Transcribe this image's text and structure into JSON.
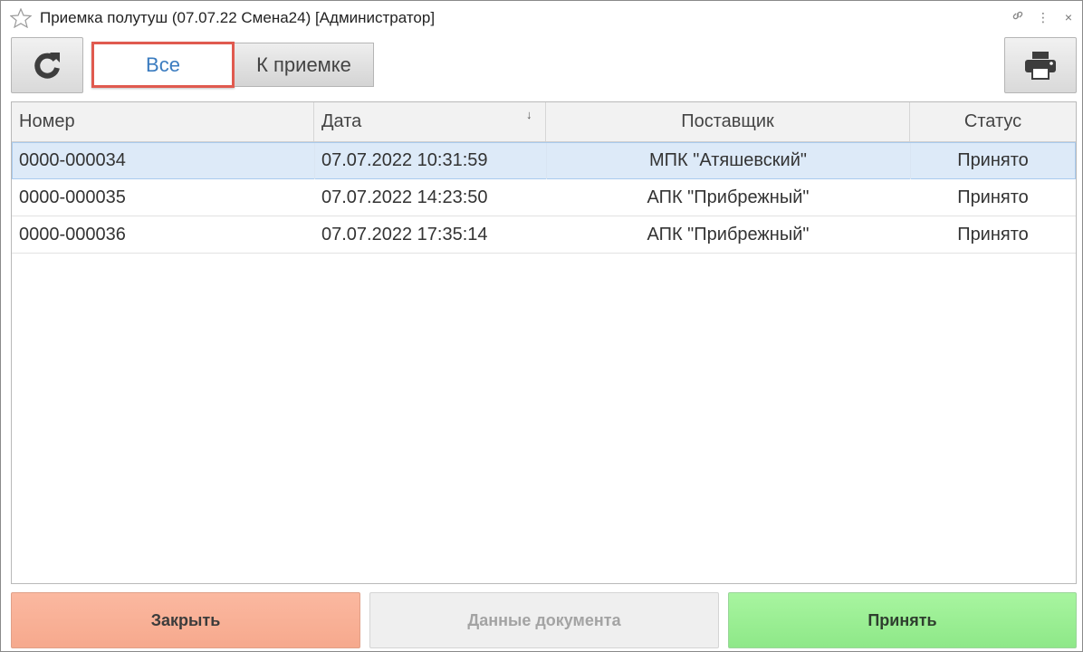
{
  "window": {
    "title": "Приемка полутуш (07.07.22 Смена24) [Администратор]",
    "icons": {
      "star": "star-outline-icon",
      "link": "link-icon",
      "menu": "more-vertical-icon",
      "close": "close-icon"
    }
  },
  "toolbar": {
    "refresh_icon": "refresh-icon",
    "filter_all": "Все",
    "filter_to_accept": "К приемке",
    "print_icon": "printer-icon",
    "selected_filter": "Все"
  },
  "table": {
    "columns": [
      "Номер",
      "Дата",
      "Поставщик",
      "Статус"
    ],
    "sort_indicator": "↓",
    "rows": [
      {
        "number": "0000-000034",
        "date": "07.07.2022 10:31:59",
        "supplier": "МПК \"Атяшевский\"",
        "status": "Принято",
        "selected": true
      },
      {
        "number": "0000-000035",
        "date": "07.07.2022 14:23:50",
        "supplier": "АПК \"Прибрежный\"",
        "status": "Принято",
        "selected": false
      },
      {
        "number": "0000-000036",
        "date": "07.07.2022 17:35:14",
        "supplier": "АПК \"Прибрежный\"",
        "status": "Принято",
        "selected": false
      }
    ]
  },
  "footer": {
    "close_label": "Закрыть",
    "doc_data_label": "Данные документа",
    "accept_label": "Принять"
  },
  "colors": {
    "accent_blue": "#3a7bbf",
    "highlight_red": "#e05a4f",
    "selected_row": "#ddeaf8",
    "close_btn": "#f6a98d",
    "accept_btn": "#8ee888"
  }
}
